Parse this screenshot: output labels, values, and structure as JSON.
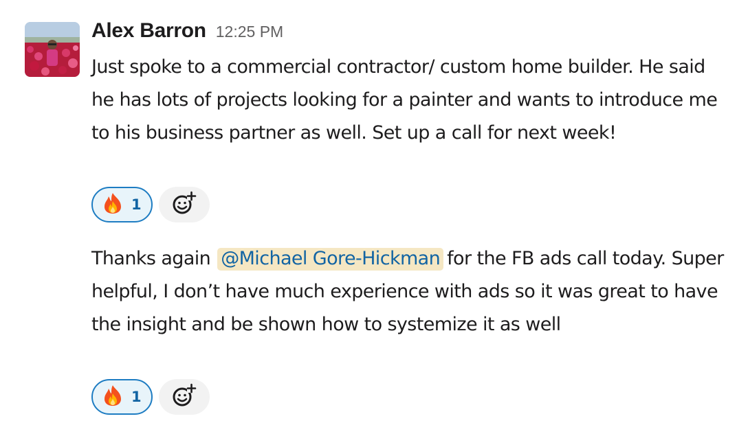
{
  "message": {
    "sender": "Alex Barron",
    "time": "12:25 PM",
    "posts": [
      {
        "text": "Just spoke to a commercial contractor/ custom home builder. He said he has lots of projects looking for a painter and wants to introduce me to his business partner as well. Set up a call for next week!",
        "reaction": {
          "emoji": "fire-emoji",
          "count": "1"
        }
      },
      {
        "text_before": "Thanks again",
        "mention": "@Michael Gore-Hickman",
        "text_after": "for the FB ads call today. Super helpful, I don’t have much experience with ads so it was great to have the insight and be shown how to systemize it as well",
        "reaction": {
          "emoji": "fire-emoji",
          "count": "1"
        }
      }
    ],
    "add_reaction_icon": "add-reaction-icon"
  },
  "colors": {
    "mention_bg": "#f5e7c3",
    "mention_text": "#1264a3",
    "reaction_border": "#1d7cc2",
    "reaction_bg": "#e8f4fa",
    "timestamp": "#616061"
  }
}
